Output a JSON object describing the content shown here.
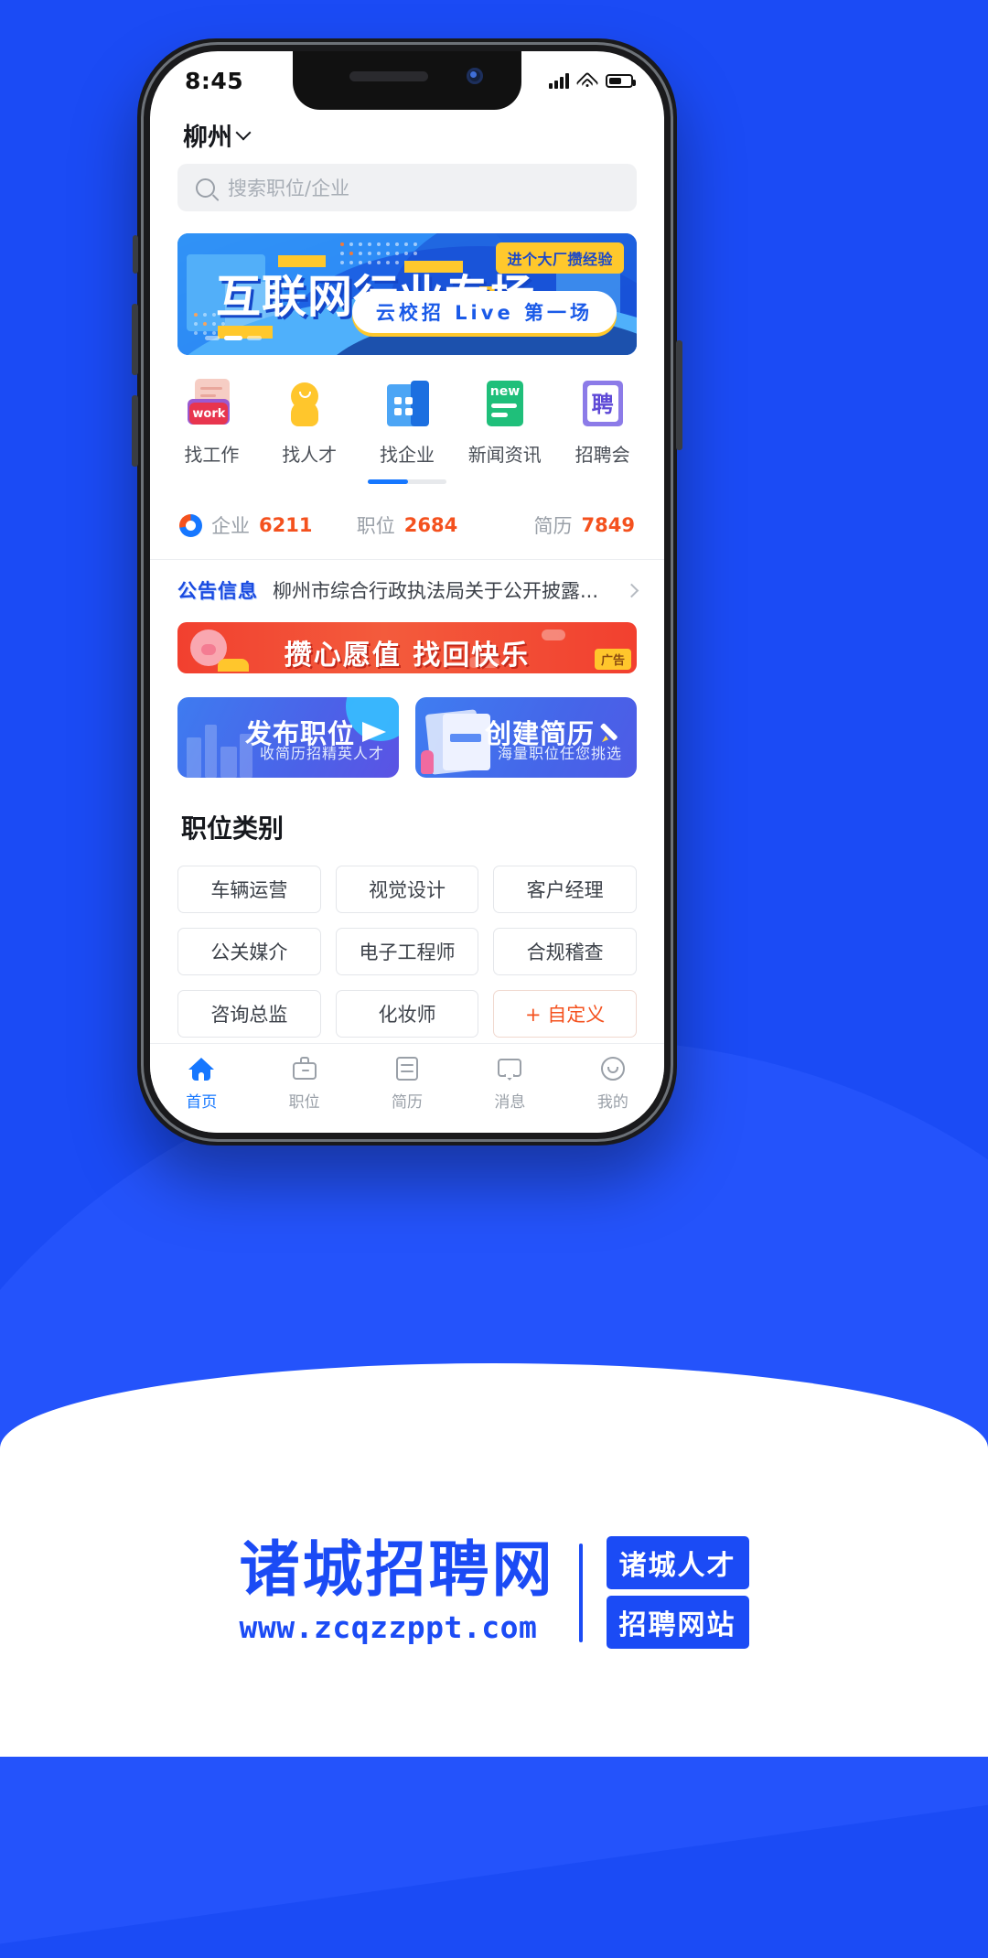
{
  "status_bar": {
    "time": "8:45",
    "icons": [
      "signal-icon",
      "wifi-icon",
      "battery-icon"
    ]
  },
  "header": {
    "city": "柳州",
    "city_chevron": "chevron-down-icon"
  },
  "search": {
    "icon": "search-icon",
    "placeholder": "搜索职位/企业"
  },
  "banner": {
    "title": "互联网行业专场",
    "tag": "进个大厂攒经验",
    "pill": "云校招 Live 第一场",
    "dots_total": 3,
    "dots_active": 2
  },
  "quick_actions": [
    {
      "label": "找工作",
      "icon": "work-badge-icon",
      "badge_text": "work"
    },
    {
      "label": "找人才",
      "icon": "talent-person-icon"
    },
    {
      "label": "找企业",
      "icon": "company-building-icon"
    },
    {
      "label": "新闻资讯",
      "icon": "news-sheet-icon",
      "badge_text": "new"
    },
    {
      "label": "招聘会",
      "icon": "recruit-fair-icon",
      "badge_text": "聘"
    }
  ],
  "stats": [
    {
      "label": "企业",
      "value": "6211",
      "icon": "donut-chart-icon"
    },
    {
      "label": "职位",
      "value": "2684"
    },
    {
      "label": "简历",
      "value": "7849"
    }
  ],
  "announcement": {
    "badge": "公告信息",
    "text": "柳州市综合行政执法局关于公开披露...",
    "arrow": "chevron-right-icon"
  },
  "ad": {
    "text": "攒心愿值 找回快乐",
    "tag": "广告"
  },
  "action_cards": [
    {
      "title": "发布职位",
      "subtitle": "收简历招精英人才",
      "icon": "paper-plane-icon"
    },
    {
      "title": "创建简历",
      "subtitle": "海量职位任您挑选",
      "icon": "pencil-icon"
    }
  ],
  "job_categories": {
    "title": "职位类别",
    "items": [
      "车辆运营",
      "视觉设计",
      "客户经理",
      "公关媒介",
      "电子工程师",
      "合规稽查",
      "咨询总监",
      "化妆师",
      "+ 自定义"
    ]
  },
  "tabbar": [
    {
      "label": "首页",
      "icon": "home-icon",
      "active": true
    },
    {
      "label": "职位",
      "icon": "briefcase-icon",
      "active": false
    },
    {
      "label": "简历",
      "icon": "resume-icon",
      "active": false
    },
    {
      "label": "消息",
      "icon": "message-icon",
      "active": false
    },
    {
      "label": "我的",
      "icon": "profile-icon",
      "active": false
    }
  ],
  "footer": {
    "brand": "诸城招聘网",
    "url": "www.zcqzzppt.com",
    "pill_line1": "诸城人才",
    "pill_line2": "招聘网站"
  },
  "colors": {
    "page_bg": "#1B4BF5",
    "accent": "#1677FF",
    "orange": "#F4511E",
    "yellow": "#FFC62C",
    "ad_red": "#F2402F"
  }
}
